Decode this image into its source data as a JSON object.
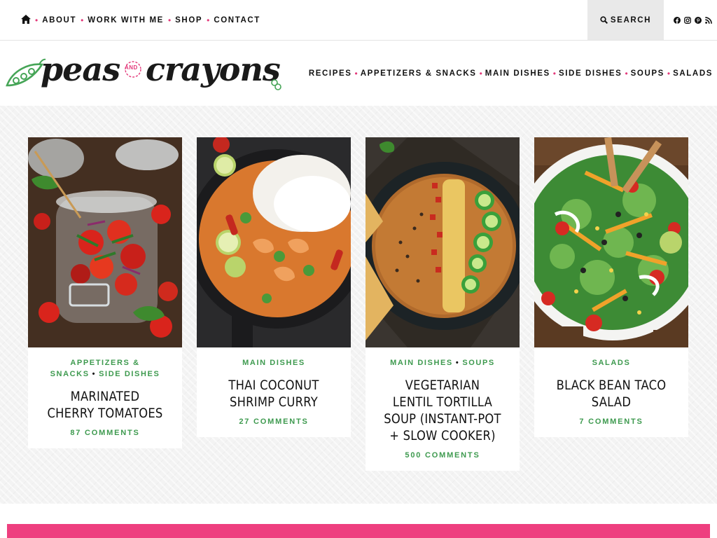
{
  "topnav": {
    "home_icon": "home-icon",
    "items": [
      "ABOUT",
      "WORK WITH ME",
      "SHOP",
      "CONTACT"
    ],
    "search_label": "SEARCH",
    "social_icons": [
      "facebook-icon",
      "instagram-icon",
      "pinterest-icon",
      "rss-icon"
    ]
  },
  "logo": {
    "word1": "peas",
    "and": "AND",
    "word2": "crayons"
  },
  "mainnav": [
    "RECIPES",
    "APPETIZERS & SNACKS",
    "MAIN DISHES",
    "SIDE DISHES",
    "SOUPS",
    "SALADS"
  ],
  "cards": [
    {
      "cats": [
        "APPETIZERS & SNACKS",
        "SIDE DISHES"
      ],
      "title": "MARINATED CHERRY TOMATOES",
      "comments": "87 COMMENTS"
    },
    {
      "cats": [
        "MAIN DISHES"
      ],
      "title": "THAI COCONUT SHRIMP CURRY",
      "comments": "27 COMMENTS"
    },
    {
      "cats": [
        "MAIN DISHES",
        "SOUPS"
      ],
      "title": "VEGETARIAN LENTIL TORTILLA SOUP (INSTANT-POT + SLOW COOKER)",
      "comments": "500 COMMENTS"
    },
    {
      "cats": [
        "SALADS"
      ],
      "title": "BLACK BEAN TACO SALAD",
      "comments": "7 COMMENTS"
    }
  ],
  "colors": {
    "accent_pink": "#e3397a",
    "category_green": "#3e9a4f",
    "banner_pink": "#ee3f7f"
  }
}
